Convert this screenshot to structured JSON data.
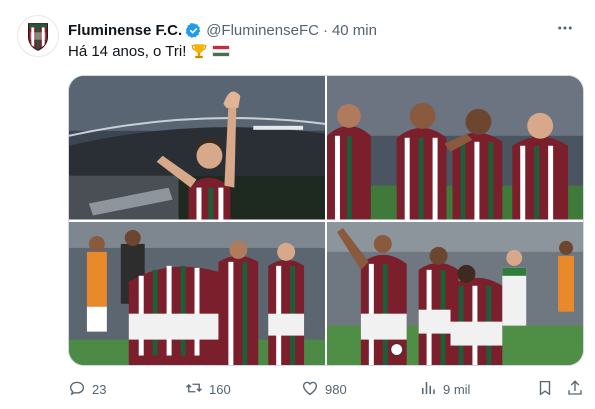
{
  "tweet": {
    "author_name": "Fluminense F.C.",
    "author_handle": "@FluminenseFC",
    "separator": "·",
    "time": "40 min",
    "text": "Há 14 anos, o Tri!",
    "emojis": [
      "trophy",
      "hungary-flag"
    ]
  },
  "colors": {
    "text_primary": "#0f1419",
    "text_secondary": "#536471",
    "verified": "#1d9bf0",
    "fluminense_maroon": "#7a1f2b",
    "fluminense_green": "#1f5c3a",
    "border": "#cfd9de"
  },
  "media": {
    "photos": [
      {
        "name": "photo-player-waving"
      },
      {
        "name": "photo-team-hug"
      },
      {
        "name": "photo-group-huddle"
      },
      {
        "name": "photo-players-celebrating"
      }
    ]
  },
  "actions": {
    "replies": "23",
    "retweets": "160",
    "likes": "980",
    "views": "9 mil"
  },
  "icons": [
    "more-icon",
    "reply-icon",
    "retweet-icon",
    "like-icon",
    "views-icon",
    "bookmark-icon",
    "share-icon",
    "verified-icon"
  ]
}
